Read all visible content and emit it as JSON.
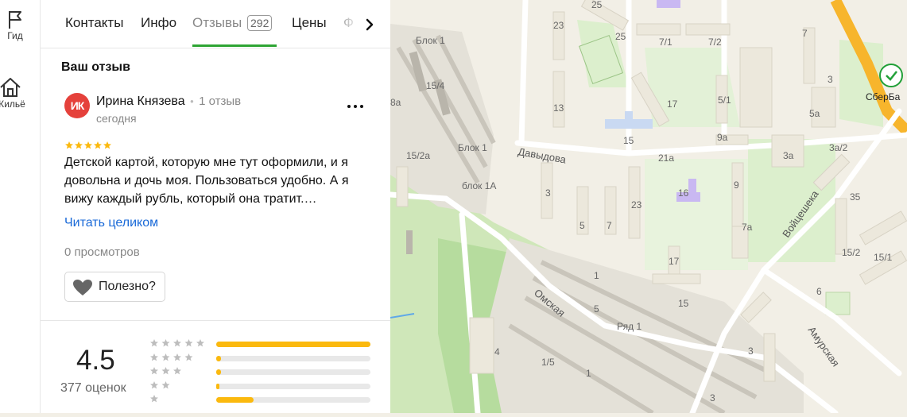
{
  "rail": {
    "items": [
      {
        "label": "Гид",
        "icon": "flag-icon"
      },
      {
        "label": "Жильё",
        "icon": "house-icon"
      }
    ]
  },
  "tabs": {
    "contacts": "Контакты",
    "info": "Инфо",
    "reviews": "Отзывы",
    "reviews_count": "292",
    "prices": "Цены",
    "photos_partial": "Ф"
  },
  "my_review": {
    "section_title": "Ваш отзыв",
    "avatar_initials": "ИК",
    "author_name": "Ирина Князева",
    "author_reviews": "1 отзыв",
    "date": "сегодня",
    "rating": 5,
    "text": "Детской картой, которую мне тут оформили, и я довольна и дочь моя. Пользоваться удобно. А я вижу каждый рубль, который она тратит.…",
    "read_more": "Читать целиком",
    "views": "0 просмотров",
    "useful_label": "Полезно?"
  },
  "summary": {
    "rating": "4.5",
    "count": "377 оценок",
    "histogram": [
      {
        "stars": 5,
        "fraction": 1.0
      },
      {
        "stars": 4,
        "fraction": 0.03
      },
      {
        "stars": 3,
        "fraction": 0.03
      },
      {
        "stars": 2,
        "fraction": 0.02
      },
      {
        "stars": 1,
        "fraction": 0.24
      }
    ]
  },
  "map": {
    "streets": [
      "Давыдова",
      "Омская",
      "Войцешека",
      "Амурская",
      "Ряд 1"
    ],
    "blocks": [
      "Блок 1",
      "15/4",
      "15/2а",
      "Блок 1",
      "блок 1А",
      "8а"
    ],
    "poi": "СберБа",
    "house_numbers": [
      "25",
      "25",
      "23",
      "13",
      "7/1",
      "7/2",
      "17",
      "15",
      "9а",
      "21а",
      "16",
      "5/1",
      "5а",
      "3а",
      "3а/2",
      "7",
      "3",
      "35",
      "3",
      "5",
      "7",
      "23",
      "9",
      "7а",
      "17",
      "15",
      "15/2",
      "15/1",
      "6",
      "1",
      "5",
      "4",
      "1/5",
      "1",
      "3"
    ],
    "colors": {
      "road": "#ffffff",
      "park": "#d4ebc0",
      "building": "#e8e4d8",
      "highway": "#f7b52c",
      "block": "#b9b5ab",
      "school": "#c9b8f2",
      "water": "#5fa8e8"
    }
  }
}
